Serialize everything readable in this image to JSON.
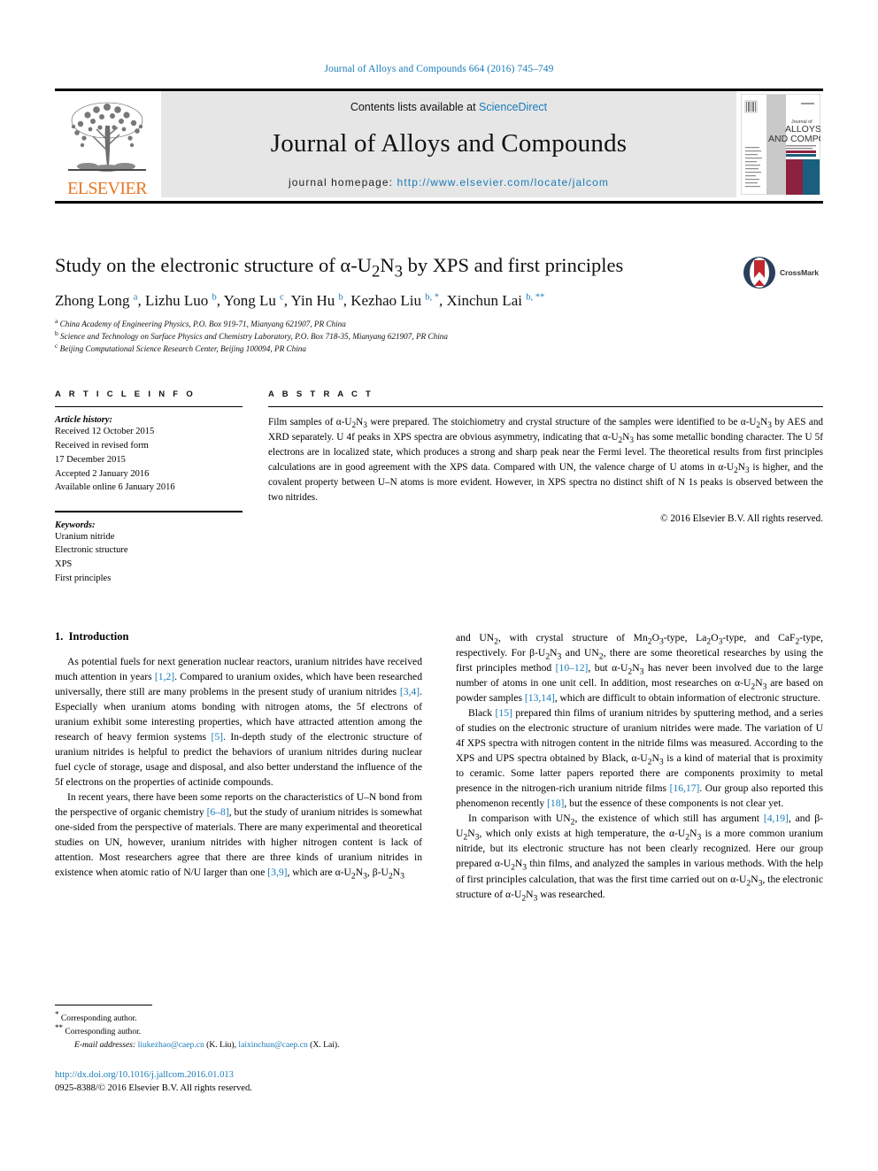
{
  "running_head": "Journal of Alloys and Compounds 664 (2016) 745–749",
  "masthead": {
    "publisher_name": "ELSEVIER",
    "contents_prefix": "Contents lists available at ",
    "contents_link": "ScienceDirect",
    "journal_title": "Journal of Alloys and Compounds",
    "homepage_prefix": "journal homepage: ",
    "homepage_url": "http://www.elsevier.com/locate/jalcom",
    "cover": {
      "line1": "Journal of",
      "line2": "ALLOYS",
      "line3": "AND COMPOUNDS"
    }
  },
  "article": {
    "title_parts": {
      "before": "Study on the electronic structure of α-U",
      "sub1": "2",
      "mid": "N",
      "sub2": "3",
      "after": " by XPS and first principles"
    },
    "crossmark_label": "CrossMark",
    "authors": [
      {
        "name": "Zhong Long",
        "marks": "a"
      },
      {
        "name": "Lizhu Luo",
        "marks": "b"
      },
      {
        "name": "Yong Lu",
        "marks": "c"
      },
      {
        "name": "Yin Hu",
        "marks": "b"
      },
      {
        "name": "Kezhao Liu",
        "marks": "b, *"
      },
      {
        "name": "Xinchun Lai",
        "marks": "b, **"
      }
    ],
    "affiliations": [
      {
        "mark": "a",
        "text": "China Academy of Engineering Physics, P.O. Box 919-71, Mianyang 621907, PR China"
      },
      {
        "mark": "b",
        "text": "Science and Technology on Surface Physics and Chemistry Laboratory, P.O. Box 718-35, Mianyang 621907, PR China"
      },
      {
        "mark": "c",
        "text": "Beijing Computational Science Research Center, Beijing 100094, PR China"
      }
    ]
  },
  "article_info": {
    "heading": "A R T I C L E   I N F O",
    "history_label": "Article history:",
    "history": [
      "Received 12 October 2015",
      "Received in revised form",
      "17 December 2015",
      "Accepted 2 January 2016",
      "Available online 6 January 2016"
    ],
    "keywords_label": "Keywords:",
    "keywords": [
      "Uranium nitride",
      "Electronic structure",
      "XPS",
      "First principles"
    ]
  },
  "abstract": {
    "heading": "A B S T R A C T",
    "text": "Film samples of α-U2N3 were prepared. The stoichiometry and crystal structure of the samples were identified to be α-U2N3 by AES and XRD separately. U 4f peaks in XPS spectra are obvious asymmetry, indicating that α-U2N3 has some metallic bonding character. The U 5f electrons are in localized state, which produces a strong and sharp peak near the Fermi level. The theoretical results from first principles calculations are in good agreement with the XPS data. Compared with UN, the valence charge of U atoms in α-U2N3 is higher, and the covalent property between U–N atoms is more evident. However, in XPS spectra no distinct shift of N 1s peaks is observed between the two nitrides.",
    "copyright": "© 2016 Elsevier B.V. All rights reserved."
  },
  "body": {
    "section_number": "1.",
    "section_title": "Introduction",
    "left_paragraphs": [
      "As potential fuels for next generation nuclear reactors, uranium nitrides have received much attention in years [1,2]. Compared to uranium oxides, which have been researched universally, there still are many problems in the present study of uranium nitrides [3,4]. Especially when uranium atoms bonding with nitrogen atoms, the 5f electrons of uranium exhibit some interesting properties, which have attracted attention among the research of heavy fermion systems [5]. In-depth study of the electronic structure of uranium nitrides is helpful to predict the behaviors of uranium nitrides during nuclear fuel cycle of storage, usage and disposal, and also better understand the influence of the 5f electrons on the properties of actinide compounds.",
      "In recent years, there have been some reports on the characteristics of U–N bond from the perspective of organic chemistry [6–8], but the study of uranium nitrides is somewhat one-sided from the perspective of materials. There are many experimental and theoretical studies on UN, however, uranium nitrides with higher nitrogen content is lack of attention. Most researchers agree that there are three kinds of uranium nitrides in existence when atomic ratio of N/U larger than one [3,9], which are α-U2N3, β-U2N3"
    ],
    "right_paragraphs": [
      "and UN2, with crystal structure of Mn2O3-type, La2O3-type, and CaF2-type, respectively. For β-U2N3 and UN2, there are some theoretical researches by using the first principles method [10–12], but α-U2N3 has never been involved due to the large number of atoms in one unit cell. In addition, most researches on α-U2N3 are based on powder samples [13,14], which are difficult to obtain information of electronic structure.",
      "Black [15] prepared thin films of uranium nitrides by sputtering method, and a series of studies on the electronic structure of uranium nitrides were made. The variation of U 4f XPS spectra with nitrogen content in the nitride films was measured. According to the XPS and UPS spectra obtained by Black, α-U2N3 is a kind of material that is proximity to ceramic. Some latter papers reported there are components proximity to metal presence in the nitrogen-rich uranium nitride films [16,17]. Our group also reported this phenomenon recently [18], but the essence of these components is not clear yet.",
      "In comparison with UN2, the existence of which still has argument [4,19], and β-U2N3, which only exists at high temperature, the α-U2N3 is a more common uranium nitride, but its electronic structure has not been clearly recognized. Here our group prepared α-U2N3 thin films, and analyzed the samples in various methods. With the help of first principles calculation, that was the first time carried out on α-U2N3, the electronic structure of α-U2N3 was researched."
    ]
  },
  "footnotes": {
    "corr1_mark": "*",
    "corr1": "Corresponding author.",
    "corr2_mark": "**",
    "corr2": "Corresponding author.",
    "email_label": "E-mail addresses:",
    "email1": "liukezhao@caep.cn",
    "email1_who": "(K. Liu)",
    "email2": "laixinchun@caep.cn",
    "email2_who": "(X. Lai)"
  },
  "footer": {
    "doi": "http://dx.doi.org/10.1016/j.jallcom.2016.01.013",
    "issn_line": "0925-8388/© 2016 Elsevier B.V. All rights reserved."
  },
  "colors": {
    "link": "#1a7bb9",
    "elsevier_orange": "#E87722",
    "panel_grey": "#e6e6e6",
    "cover_maroon": "#8c2140",
    "cover_blue": "#1b5f7e",
    "crossmark_red": "#c1272d"
  }
}
